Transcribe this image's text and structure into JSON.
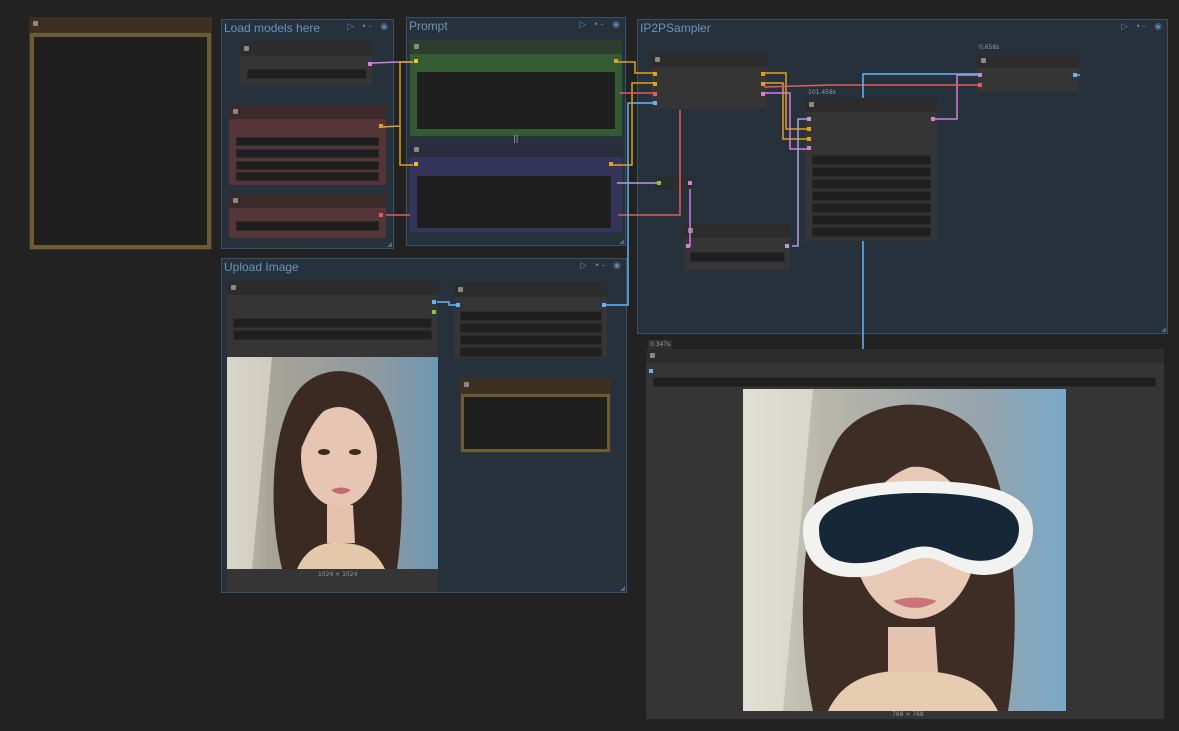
{
  "groups": {
    "load_models": {
      "title": "Load models here"
    },
    "prompt": {
      "title": "Prompt",
      "connector": "||"
    },
    "ip2p": {
      "title": "IP2PSampler"
    },
    "upload": {
      "title": "Upload Image"
    }
  },
  "group_icons": "▷ •‑ ◉",
  "timings": {
    "node_a": "0.658s",
    "node_b": "101.458s",
    "output": "0.347s"
  },
  "images": {
    "input_caption": "1024 × 1024",
    "output_caption": "768 × 768"
  },
  "colors": {
    "canvas": "#222222",
    "group_bg": "#26313c",
    "group_title": "#6c93b8"
  }
}
